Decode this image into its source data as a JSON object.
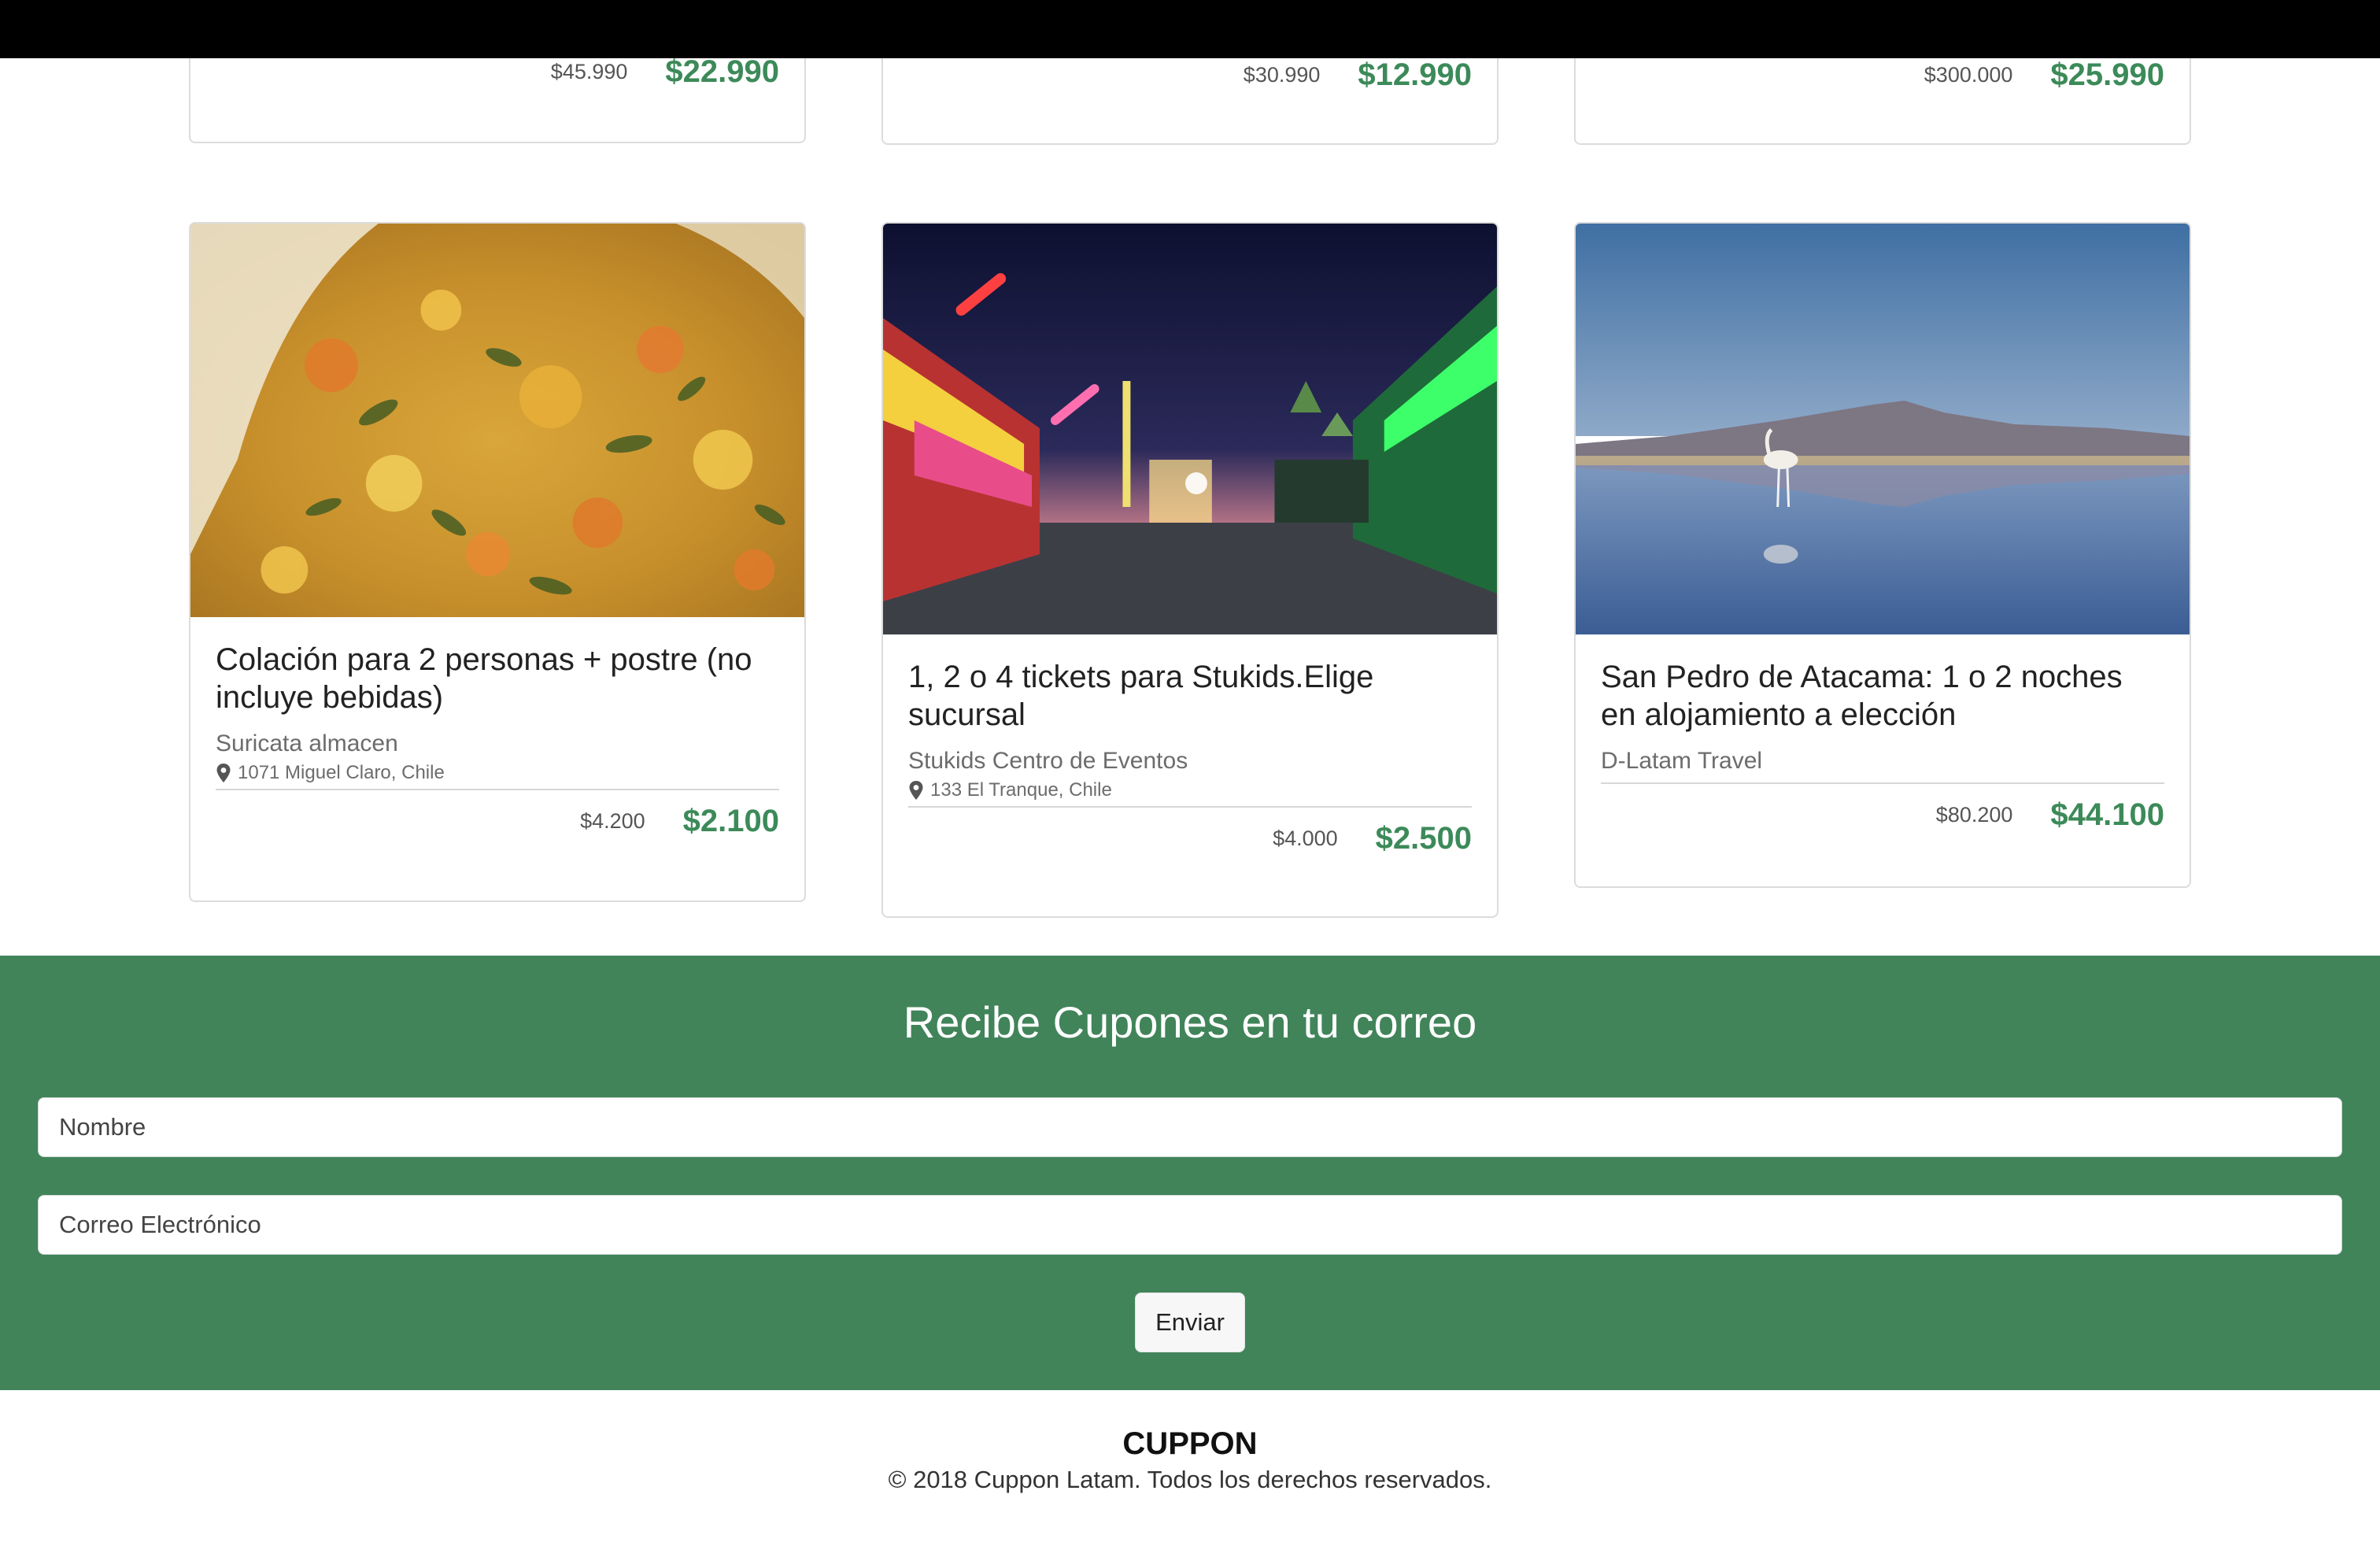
{
  "top_row": [
    {
      "price_old": "$45.990",
      "price_new": "$22.990"
    },
    {
      "price_old": "$30.990",
      "price_new": "$12.990"
    },
    {
      "price_old": "$300.000",
      "price_new": "$25.990"
    }
  ],
  "cards": [
    {
      "image": "food-stew-photo",
      "title": "Colación para 2 personas + postre (no incluye bebidas)",
      "merchant": "Suricata almacen",
      "address": "1071 Miguel Claro, Chile",
      "price_old": "$4.200",
      "price_new": "$2.100"
    },
    {
      "image": "amusement-park-night-photo",
      "title": "1, 2 o 4 tickets para Stukids.Elige sucursal",
      "merchant": "Stukids Centro de Eventos",
      "address": "133 El Tranque, Chile",
      "price_old": "$4.000",
      "price_new": "$2.500"
    },
    {
      "image": "atacama-flamingo-lake-photo",
      "title": "San Pedro de Atacama: 1 o 2 noches en alojamiento a elección",
      "merchant": "D-Latam Travel",
      "address": "",
      "price_old": "$80.200",
      "price_new": "$44.100"
    }
  ],
  "newsletter": {
    "title": "Recibe Cupones en tu correo",
    "name_placeholder": "Nombre",
    "email_placeholder": "Correo Electrónico",
    "submit_label": "Enviar"
  },
  "footer": {
    "brand": "CUPPON",
    "copyright": "© 2018 Cuppon Latam. Todos los derechos reservados."
  },
  "colors": {
    "accent_green": "#41845a",
    "price_green": "#3c8a59",
    "top_bar": "#000000"
  },
  "icons": [
    "map-pin-icon"
  ]
}
